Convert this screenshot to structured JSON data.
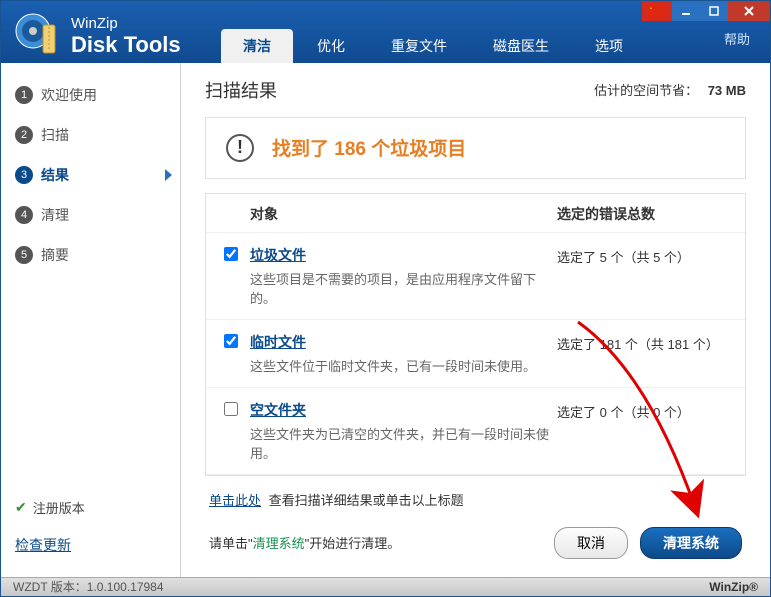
{
  "titlebar": {
    "brand_top": "WinZip",
    "brand_bottom": "Disk Tools",
    "help": "帮助"
  },
  "tabs": [
    {
      "label": "清洁",
      "active": true
    },
    {
      "label": "优化",
      "active": false
    },
    {
      "label": "重复文件",
      "active": false
    },
    {
      "label": "磁盘医生",
      "active": false
    },
    {
      "label": "选项",
      "active": false
    }
  ],
  "sidebar": {
    "steps": [
      {
        "num": "1",
        "label": "欢迎使用",
        "state": "done"
      },
      {
        "num": "2",
        "label": "扫描",
        "state": "done"
      },
      {
        "num": "3",
        "label": "结果",
        "state": "active"
      },
      {
        "num": "4",
        "label": "清理",
        "state": ""
      },
      {
        "num": "5",
        "label": "摘要",
        "state": ""
      }
    ],
    "registered": "注册版本",
    "check_update": "检查更新"
  },
  "main": {
    "title": "扫描结果",
    "space_saved_label": "估计的空间节省：",
    "space_saved_value": "73 MB",
    "alert": "找到了 186 个垃圾项目",
    "col_object": "对象",
    "col_errors": "选定的错误总数",
    "rows": [
      {
        "checked": true,
        "title": "垃圾文件",
        "desc": "这些项目是不需要的项目，是由应用程序文件留下的。",
        "count": "选定了 5 个（共 5 个）"
      },
      {
        "checked": true,
        "title": "临时文件",
        "desc": "这些文件位于临时文件夹，已有一段时间未使用。",
        "count": "选定了 181 个（共 181 个）"
      },
      {
        "checked": false,
        "title": "空文件夹",
        "desc": "这些文件夹为已清空的文件夹，并已有一段时间未使用。",
        "count": "选定了 0 个（共 0 个）"
      }
    ],
    "details_link": "单击此处",
    "details_text": "查看扫描详细结果或单击以上标题",
    "action_prefix": "请单击\"",
    "action_btn_name": "清理系统",
    "action_suffix": "\"开始进行清理。",
    "cancel": "取消",
    "clean": "清理系统"
  },
  "statusbar": {
    "version_label": "WZDT 版本：",
    "version": "1.0.100.17984",
    "brand": "WinZip®"
  }
}
